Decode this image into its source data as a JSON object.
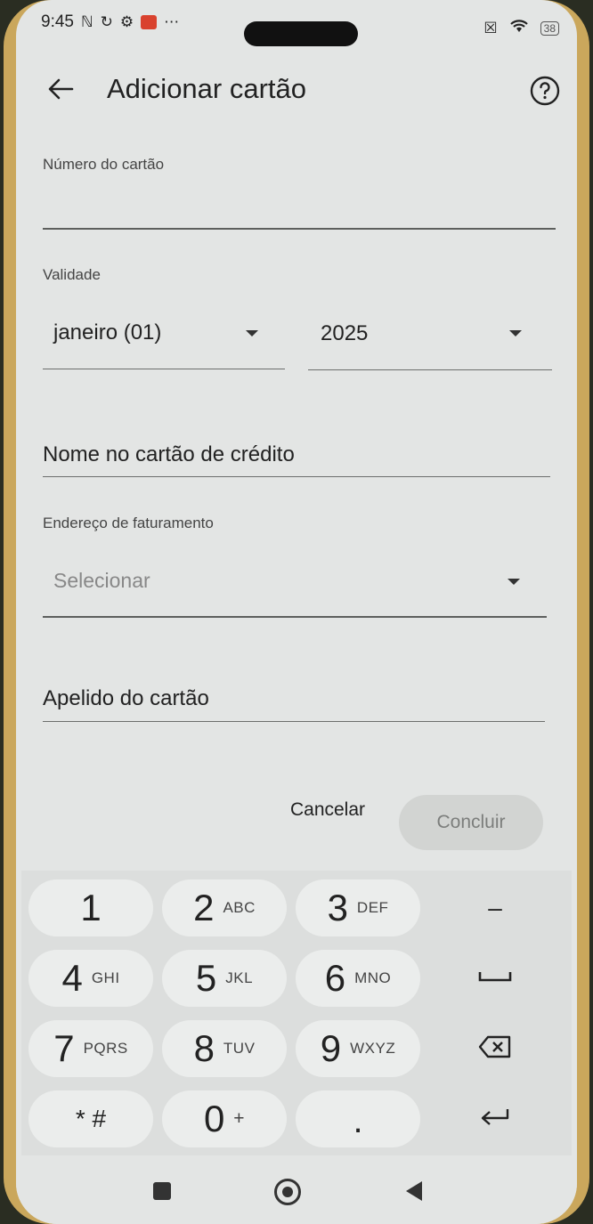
{
  "status_bar": {
    "time": "9:45",
    "battery": "38"
  },
  "header": {
    "title": "Adicionar cartão",
    "back_icon": "arrow-left-icon",
    "help_icon": "question-circle-icon"
  },
  "form": {
    "card_number_label": "Número do cartão",
    "card_number_value": "",
    "expiry_label": "Validade",
    "expiry_month": "janeiro (01)",
    "expiry_year": "2025",
    "cardholder_placeholder": "Nome no cartão de crédito",
    "billing_address_label": "Endereço de faturamento",
    "billing_address_placeholder": "Selecionar",
    "nickname_placeholder": "Apelido do cartão"
  },
  "actions": {
    "cancel_label": "Cancelar",
    "done_label": "Concluir"
  },
  "keypad": {
    "keys": [
      {
        "digit": "1",
        "letters": ""
      },
      {
        "digit": "2",
        "letters": "ABC"
      },
      {
        "digit": "3",
        "letters": "DEF"
      },
      {
        "digit": "4",
        "letters": "GHI"
      },
      {
        "digit": "5",
        "letters": "JKL"
      },
      {
        "digit": "6",
        "letters": "MNO"
      },
      {
        "digit": "7",
        "letters": "PQRS"
      },
      {
        "digit": "8",
        "letters": "TUV"
      },
      {
        "digit": "9",
        "letters": "WXYZ"
      },
      {
        "digit": "* #",
        "letters": ""
      },
      {
        "digit": "0",
        "letters": "+"
      },
      {
        "digit": ".",
        "letters": ""
      }
    ],
    "func_keys": {
      "minus": "–",
      "space": "space-icon",
      "backspace": "backspace-icon",
      "enter": "enter-icon"
    }
  },
  "colors": {
    "screen_bg": "#e3e5e4",
    "keypad_bg": "#dcdedd",
    "key_bg": "#ebedec",
    "done_btn_bg": "#d2d4d2",
    "done_btn_text": "#7c7e7c"
  }
}
